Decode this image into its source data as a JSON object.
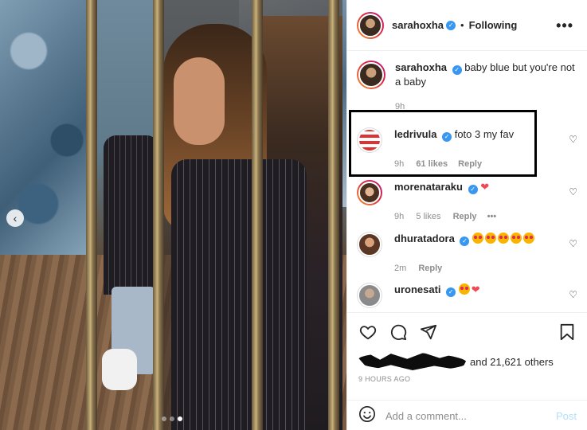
{
  "post": {
    "author": "sarahoxha",
    "follow_status": "Following",
    "caption": "baby blue but you're not a baby",
    "caption_time": "9h"
  },
  "comments": [
    {
      "user": "ledrivula",
      "text": "foto 3 my fav",
      "time": "9h",
      "likes": "61 likes",
      "reply": "Reply"
    },
    {
      "user": "morenataraku",
      "text": "",
      "time": "9h",
      "likes": "5 likes",
      "reply": "Reply"
    },
    {
      "user": "dhuratadora",
      "text": "",
      "time": "2m",
      "reply": "Reply"
    },
    {
      "user": "uronesati",
      "text": ""
    }
  ],
  "footer": {
    "likes_text": "and 21,621 others",
    "time_ago": "9 HOURS AGO",
    "comment_placeholder": "Add a comment...",
    "post_label": "Post"
  },
  "icons": [
    "more-icon",
    "verified-icon",
    "heart-icon",
    "comment-icon",
    "share-icon",
    "bookmark-icon",
    "emoji-icon",
    "chevron-left-icon"
  ],
  "colors": {
    "verified": "#3897f0",
    "red_heart": "#ed4956",
    "post_disabled": "#b2dffc",
    "muted": "#8e8e8e"
  },
  "carousel": {
    "slides": 3,
    "active": 3
  }
}
